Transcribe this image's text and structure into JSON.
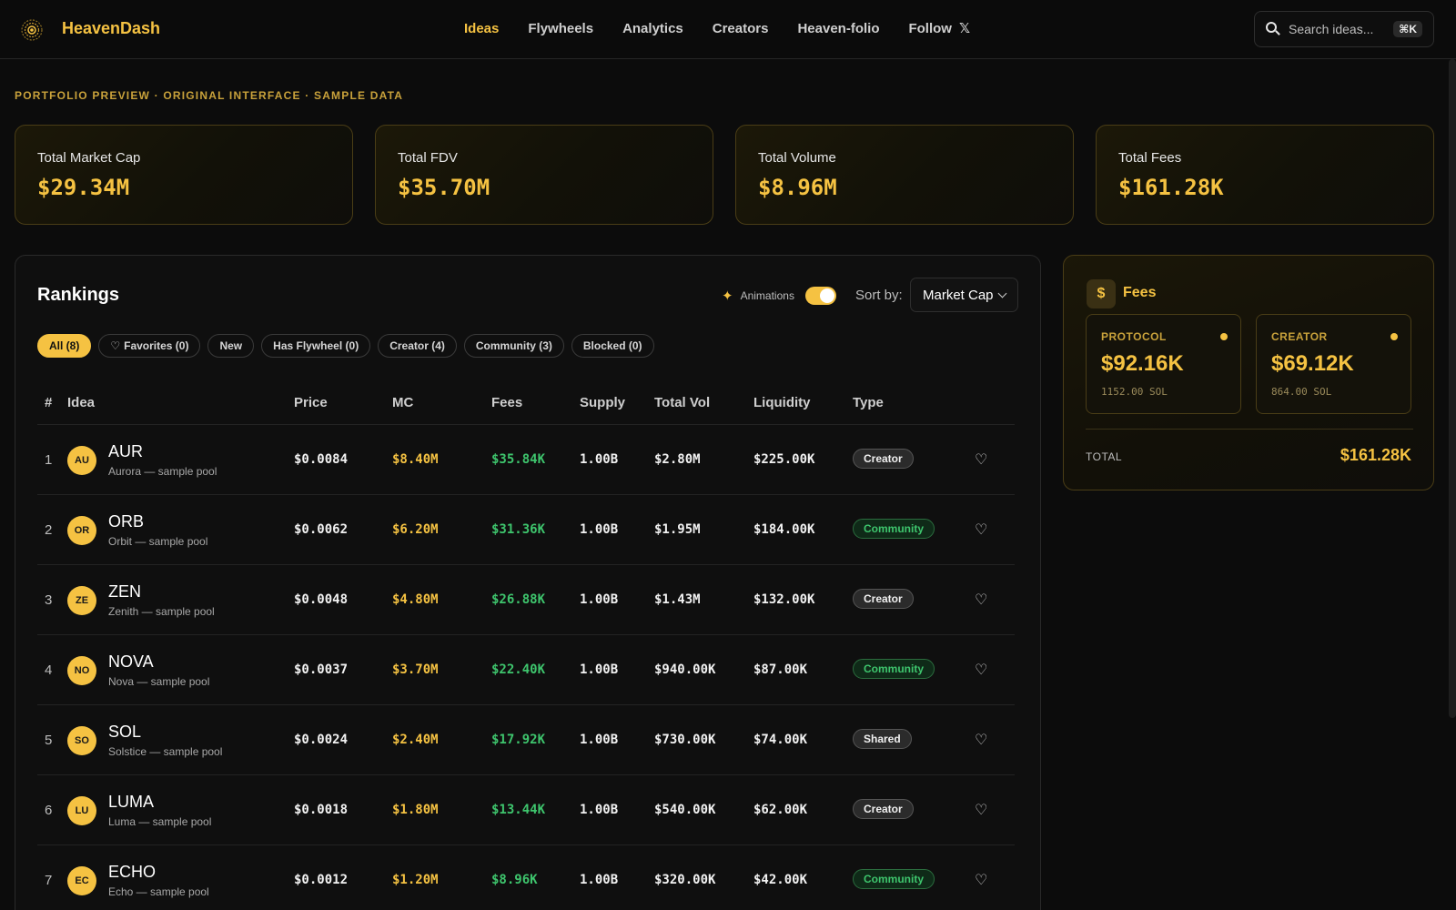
{
  "header": {
    "brand": "HeavenDash",
    "logo_icon": "sunburst-logo-icon",
    "nav": [
      {
        "label": "Ideas",
        "active": true
      },
      {
        "label": "Flywheels",
        "active": false
      },
      {
        "label": "Analytics",
        "active": false
      },
      {
        "label": "Creators",
        "active": false
      },
      {
        "label": "Heaven-folio",
        "active": false
      },
      {
        "label": "Follow",
        "active": false,
        "icon": "x-logo-icon"
      }
    ],
    "search": {
      "placeholder": "Search ideas...",
      "shortcut": "⌘K"
    }
  },
  "section_label": "PORTFOLIO PREVIEW · ORIGINAL INTERFACE · SAMPLE DATA",
  "stats": [
    {
      "label": "Total Market Cap",
      "value": "$29.34M"
    },
    {
      "label": "Total FDV",
      "value": "$35.70M"
    },
    {
      "label": "Total Volume",
      "value": "$8.96M"
    },
    {
      "label": "Total Fees",
      "value": "$161.28K"
    }
  ],
  "rankings": {
    "title": "Rankings",
    "animations_label": "Animations",
    "animations_on": true,
    "sort_label": "Sort by:",
    "sort_value": "Market Cap",
    "filters": [
      {
        "label": "All (8)",
        "active": true
      },
      {
        "label": "Favorites (0)",
        "active": false,
        "icon": "heart-icon"
      },
      {
        "label": "New",
        "active": false
      },
      {
        "label": "Has Flywheel (0)",
        "active": false
      },
      {
        "label": "Creator (4)",
        "active": false
      },
      {
        "label": "Community (3)",
        "active": false
      },
      {
        "label": "Blocked (0)",
        "active": false
      }
    ],
    "columns": [
      "#",
      "Idea",
      "Price",
      "MC",
      "Fees",
      "Supply",
      "Total Vol",
      "Liquidity",
      "Type"
    ],
    "rows": [
      {
        "rank": "1",
        "initials": "AU",
        "symbol": "AUR",
        "name": "Aurora — sample pool",
        "price": "$0.0084",
        "mc": "$8.40M",
        "fees": "$35.84K",
        "supply": "1.00B",
        "vol": "$2.80M",
        "liq": "$225.00K",
        "type": "Creator",
        "type_style": "gray"
      },
      {
        "rank": "2",
        "initials": "OR",
        "symbol": "ORB",
        "name": "Orbit — sample pool",
        "price": "$0.0062",
        "mc": "$6.20M",
        "fees": "$31.36K",
        "supply": "1.00B",
        "vol": "$1.95M",
        "liq": "$184.00K",
        "type": "Community",
        "type_style": "green"
      },
      {
        "rank": "3",
        "initials": "ZE",
        "symbol": "ZEN",
        "name": "Zenith — sample pool",
        "price": "$0.0048",
        "mc": "$4.80M",
        "fees": "$26.88K",
        "supply": "1.00B",
        "vol": "$1.43M",
        "liq": "$132.00K",
        "type": "Creator",
        "type_style": "gray"
      },
      {
        "rank": "4",
        "initials": "NO",
        "symbol": "NOVA",
        "name": "Nova — sample pool",
        "price": "$0.0037",
        "mc": "$3.70M",
        "fees": "$22.40K",
        "supply": "1.00B",
        "vol": "$940.00K",
        "liq": "$87.00K",
        "type": "Community",
        "type_style": "green"
      },
      {
        "rank": "5",
        "initials": "SO",
        "symbol": "SOL",
        "name": "Solstice — sample pool",
        "price": "$0.0024",
        "mc": "$2.40M",
        "fees": "$17.92K",
        "supply": "1.00B",
        "vol": "$730.00K",
        "liq": "$74.00K",
        "type": "Shared",
        "type_style": "gray"
      },
      {
        "rank": "6",
        "initials": "LU",
        "symbol": "LUMA",
        "name": "Luma — sample pool",
        "price": "$0.0018",
        "mc": "$1.80M",
        "fees": "$13.44K",
        "supply": "1.00B",
        "vol": "$540.00K",
        "liq": "$62.00K",
        "type": "Creator",
        "type_style": "gray"
      },
      {
        "rank": "7",
        "initials": "EC",
        "symbol": "ECHO",
        "name": "Echo — sample pool",
        "price": "$0.0012",
        "mc": "$1.20M",
        "fees": "$8.96K",
        "supply": "1.00B",
        "vol": "$320.00K",
        "liq": "$42.00K",
        "type": "Community",
        "type_style": "green"
      }
    ]
  },
  "fees": {
    "title": "Fees",
    "icon": "dollar-icon",
    "cards": [
      {
        "label": "PROTOCOL",
        "value": "$92.16K",
        "sol": "1152.00 SOL"
      },
      {
        "label": "CREATOR",
        "value": "$69.12K",
        "sol": "864.00 SOL"
      }
    ],
    "total_label": "TOTAL",
    "total_value": "$161.28K"
  },
  "colors": {
    "accent": "#f5c242",
    "positive": "#3ec56d",
    "background": "#0c0c0c"
  }
}
